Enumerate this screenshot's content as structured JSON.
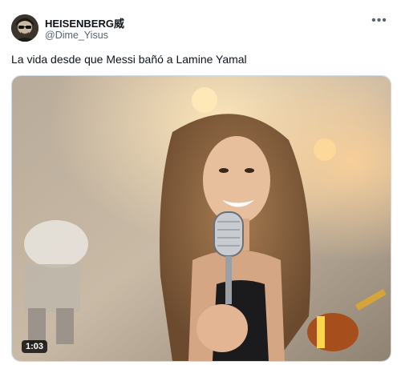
{
  "tweet": {
    "author_name": "HEISENBERG威",
    "author_handle": "@Dime_Yisus",
    "text": "La vida desde que Messi bañó a Lamine Yamal",
    "more_icon": "more-horizontal-icon",
    "avatar_icon": "sunglasses-man-avatar"
  },
  "media": {
    "type": "video",
    "duration": "1:03"
  },
  "colors": {
    "text_primary": "#0f1419",
    "text_secondary": "#536471",
    "border": "#cfd9de"
  }
}
